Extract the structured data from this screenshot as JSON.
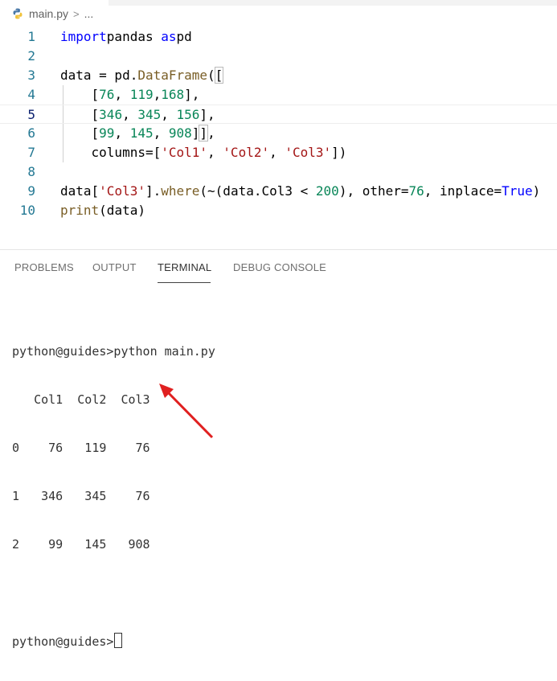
{
  "breadcrumb": {
    "file": "main.py",
    "separator": ">",
    "more": "..."
  },
  "editor": {
    "lines": [
      {
        "n": "1",
        "tokens": [
          [
            "kw",
            "import"
          ],
          [
            "",
            "pandas "
          ],
          [
            "kw",
            "as"
          ],
          [
            "",
            "pd"
          ]
        ]
      },
      {
        "n": "2",
        "tokens": []
      },
      {
        "n": "3",
        "tokens": [
          [
            "",
            "data = pd."
          ],
          [
            "fn",
            "DataFrame"
          ],
          [
            "",
            "("
          ],
          [
            "box",
            "["
          ]
        ]
      },
      {
        "n": "4",
        "tokens": [
          [
            "",
            "    ["
          ],
          [
            "num",
            "76"
          ],
          [
            "",
            ", "
          ],
          [
            "num",
            "119"
          ],
          [
            "",
            ","
          ],
          [
            "num",
            "168"
          ],
          [
            "",
            "],"
          ]
        ]
      },
      {
        "n": "5",
        "tokens": [
          [
            "",
            "    ["
          ],
          [
            "num",
            "346"
          ],
          [
            "",
            ", "
          ],
          [
            "num",
            "345"
          ],
          [
            "",
            ", "
          ],
          [
            "num",
            "156"
          ],
          [
            "",
            "],"
          ]
        ]
      },
      {
        "n": "6",
        "tokens": [
          [
            "",
            "    ["
          ],
          [
            "num",
            "99"
          ],
          [
            "",
            ", "
          ],
          [
            "num",
            "145"
          ],
          [
            "",
            ", "
          ],
          [
            "num",
            "908"
          ],
          [
            "",
            "]"
          ],
          [
            "box",
            "]"
          ],
          [
            "",
            ","
          ]
        ]
      },
      {
        "n": "7",
        "tokens": [
          [
            "",
            "    columns=["
          ],
          [
            "str",
            "'Col1'"
          ],
          [
            "",
            ", "
          ],
          [
            "str",
            "'Col2'"
          ],
          [
            "",
            ", "
          ],
          [
            "str",
            "'Col3'"
          ],
          [
            "",
            "])"
          ]
        ]
      },
      {
        "n": "8",
        "tokens": []
      },
      {
        "n": "9",
        "tokens": [
          [
            "",
            "data["
          ],
          [
            "str",
            "'Col3'"
          ],
          [
            "",
            "]."
          ],
          [
            "fn",
            "where"
          ],
          [
            "",
            "(~(data.Col3 < "
          ],
          [
            "num",
            "200"
          ],
          [
            "",
            "), other="
          ],
          [
            "num",
            "76"
          ],
          [
            "",
            ", inplace="
          ],
          [
            "kw",
            "True"
          ],
          [
            "",
            ")"
          ]
        ]
      },
      {
        "n": "10",
        "tokens": [
          [
            "fn",
            "print"
          ],
          [
            "",
            "(data)"
          ]
        ]
      }
    ],
    "active_line": "5"
  },
  "panel": {
    "tabs": [
      "PROBLEMS",
      "OUTPUT",
      "TERMINAL",
      "DEBUG CONSOLE"
    ],
    "active_tab": "TERMINAL"
  },
  "terminal": {
    "lines": [
      "python@guides>python main.py",
      "   Col1  Col2  Col3",
      "0    76   119    76",
      "1   346   345    76",
      "2    99   145   908",
      "",
      "python@guides>"
    ]
  },
  "colors": {
    "annotation_arrow": "#e02020"
  }
}
